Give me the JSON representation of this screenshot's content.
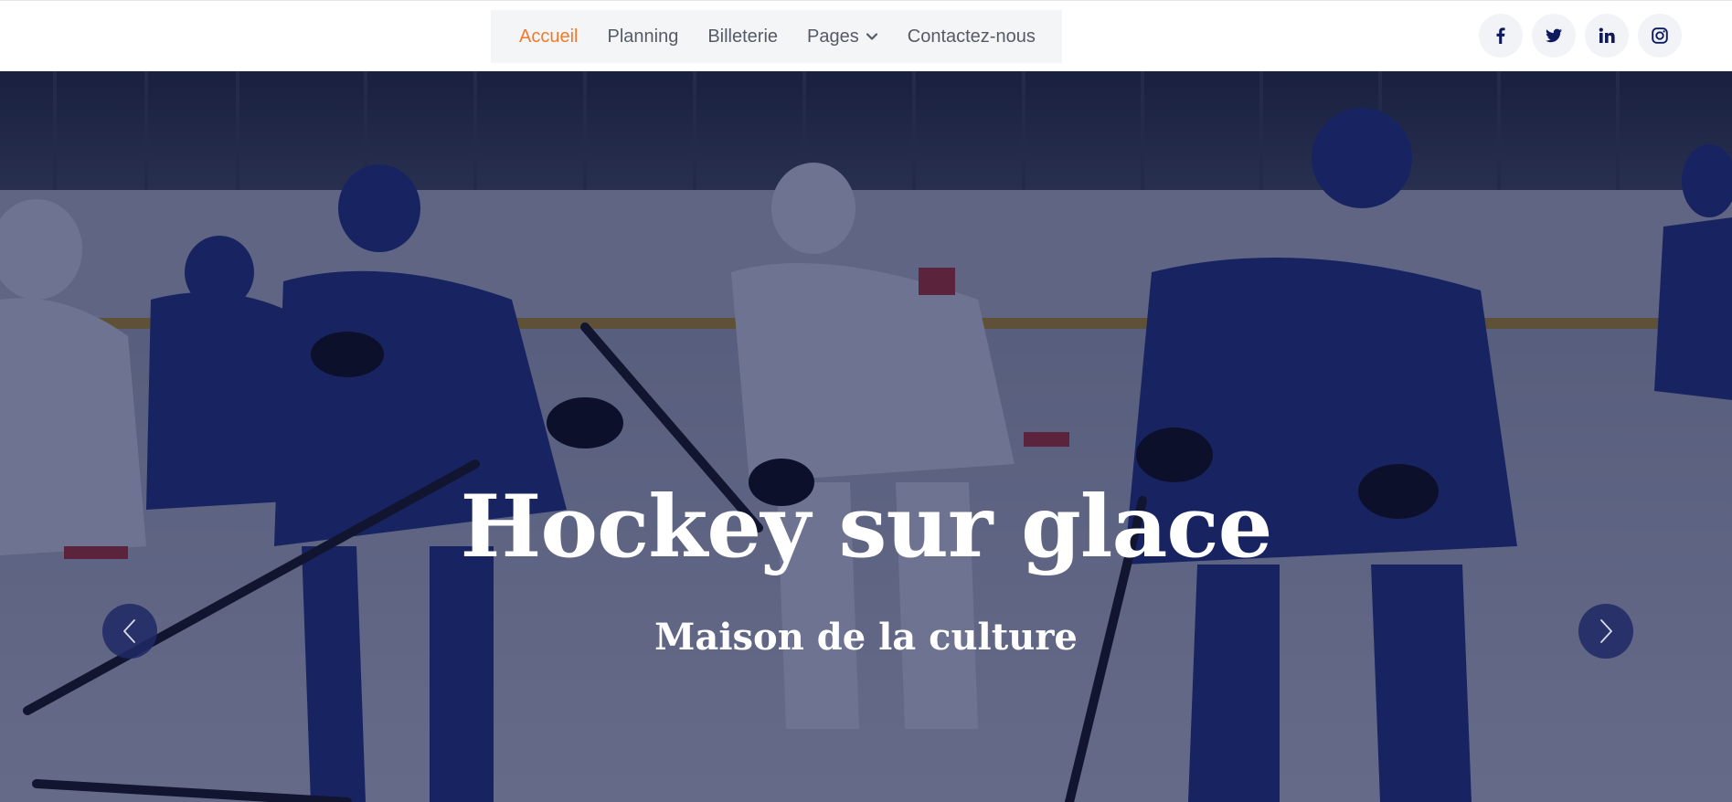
{
  "nav": {
    "items": [
      {
        "label": "Accueil",
        "active": true
      },
      {
        "label": "Planning",
        "active": false
      },
      {
        "label": "Billeterie",
        "active": false
      },
      {
        "label": "Pages",
        "active": false,
        "has_dropdown": true
      },
      {
        "label": "Contactez-nous",
        "active": false
      }
    ]
  },
  "socials": [
    {
      "icon": "facebook-icon"
    },
    {
      "icon": "twitter-icon"
    },
    {
      "icon": "linkedin-icon"
    },
    {
      "icon": "instagram-icon"
    }
  ],
  "hero": {
    "title": "Hockey sur glace",
    "subtitle": "Maison de la culture",
    "background_image": "ice hockey players skating on rink",
    "prev_icon": "chevron-left-icon",
    "next_icon": "chevron-right-icon"
  },
  "colors": {
    "accent": "#f2792a",
    "nav_text": "#555b66",
    "nav_bg": "#f4f5f7",
    "social_icon": "#0e1a5c",
    "overlay": "#0a1040"
  }
}
